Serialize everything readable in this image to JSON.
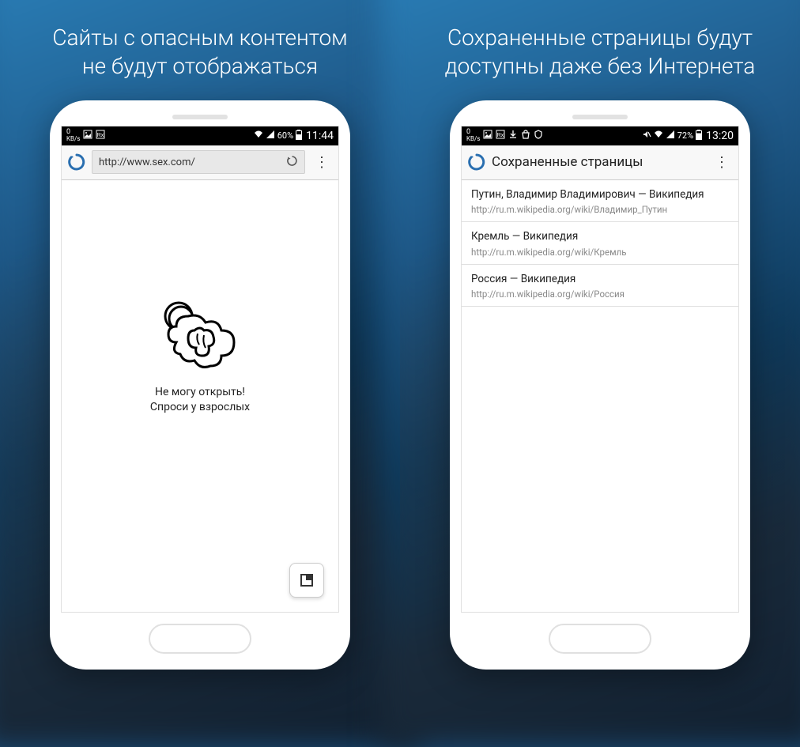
{
  "left": {
    "headline_l1": "Сайты с опасным контентом",
    "headline_l2": "не будут отображаться",
    "statusbar": {
      "kbs": "0",
      "kbs_unit": "KB/s",
      "battery": "60%",
      "time": "11:44"
    },
    "url": "http://www.sex.com/",
    "blocked_l1": "Не могу открыть!",
    "blocked_l2": "Спроси у взрослых"
  },
  "right": {
    "headline_l1": "Сохраненные страницы будут",
    "headline_l2": "доступны даже без Интернета",
    "statusbar": {
      "kbs": "0",
      "kbs_unit": "KB/s",
      "battery": "72%",
      "time": "13:20"
    },
    "toolbar_title": "Сохраненные страницы",
    "saved": [
      {
        "title": "Путин, Владимир Владимирович — Википедия",
        "url": "http://ru.m.wikipedia.org/wiki/Владимир_Путин"
      },
      {
        "title": "Кремль — Википедия",
        "url": "http://ru.m.wikipedia.org/wiki/Кремль"
      },
      {
        "title": "Россия — Википедия",
        "url": "http://ru.m.wikipedia.org/wiki/Россия"
      }
    ]
  }
}
